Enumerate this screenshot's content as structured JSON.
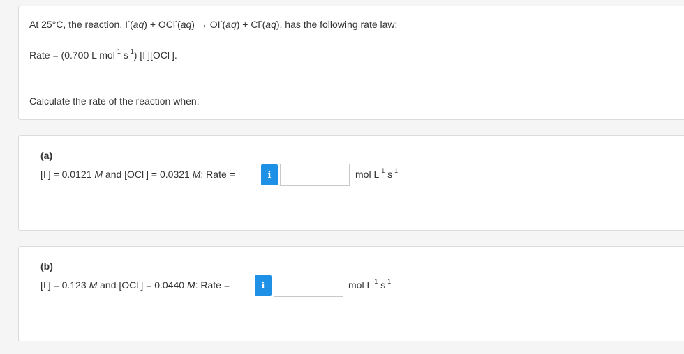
{
  "intro": {
    "prefix": "At 25°C, the reaction, I",
    "aq": "aq",
    "minus": "-",
    "plus1": " + OCl",
    "arrow": " → OI",
    "plus2": " + Cl",
    "suffix": ", has the following rate law:",
    "rate_prefix": "Rate = (0.700 L mol",
    "exp_neg1": "-1",
    "rate_s": " s",
    "rate_close": ") [I",
    "rate_mid": "][OCl",
    "rate_end": "].",
    "instruction": "Calculate the rate of the reaction when:"
  },
  "part_a": {
    "label": "(a)",
    "conc_i_prefix": "[I",
    "conc_i_val": "] = 0.0121 ",
    "M": "M",
    "and_ocl": " and [OCl",
    "conc_ocl_val": "] = 0.0321 ",
    "rate_label": ": Rate =",
    "info": "i",
    "input_value": "",
    "unit_mol": "mol L",
    "unit_s": " s"
  },
  "part_b": {
    "label": "(b)",
    "conc_i_prefix": "[I",
    "conc_i_val": "] = 0.123 ",
    "M": "M",
    "and_ocl": " and [OCl",
    "conc_ocl_val": "] = 0.0440 ",
    "rate_label": ": Rate =",
    "info": "i",
    "input_value": "",
    "unit_mol": "mol L",
    "unit_s": " s"
  },
  "colors": {
    "info_button": "#1e90e6",
    "card_border": "#dcdcdc",
    "background": "#f5f5f5"
  }
}
